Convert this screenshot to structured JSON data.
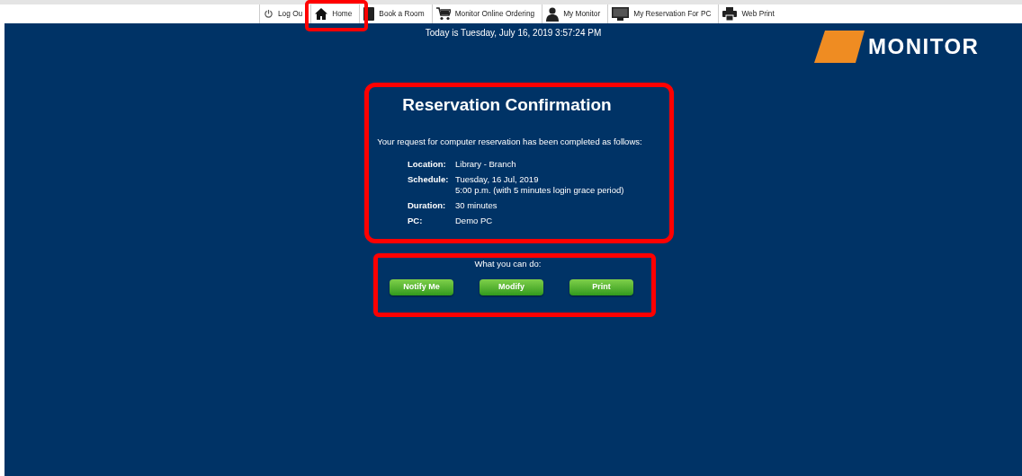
{
  "nav": [
    {
      "label": "Log Ou"
    },
    {
      "label": "Home"
    },
    {
      "label": "Book a Room"
    },
    {
      "label": "Monitor Online Ordering"
    },
    {
      "label": "My Monitor"
    },
    {
      "label": "My Reservation For PC"
    },
    {
      "label": "Web Print"
    }
  ],
  "date_line": "Today is Tuesday, July 16, 2019 3:57:24 PM",
  "logo": {
    "text": "MONITOR"
  },
  "confirmation": {
    "title": "Reservation Confirmation",
    "intro": "Your request for computer reservation has been completed as follows:",
    "details": [
      {
        "label": "Location:",
        "lines": [
          "Library - Branch"
        ]
      },
      {
        "label": "Schedule:",
        "lines": [
          "Tuesday, 16 Jul, 2019",
          "5:00 p.m. (with 5 minutes login grace period)"
        ]
      },
      {
        "label": "Duration:",
        "lines": [
          "30 minutes"
        ]
      },
      {
        "label": "PC:",
        "lines": [
          "Demo PC"
        ]
      }
    ]
  },
  "actions": {
    "heading": "What you can do:",
    "buttons": [
      "Notify Me",
      "Modify",
      "Print"
    ]
  }
}
